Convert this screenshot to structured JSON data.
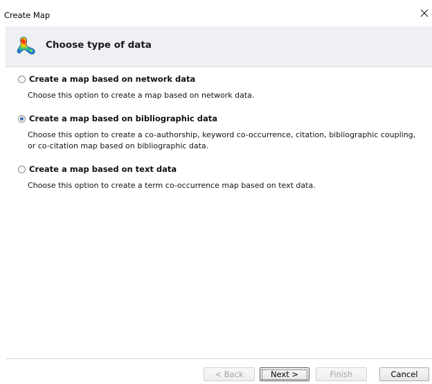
{
  "window": {
    "title": "Create Map"
  },
  "header": {
    "title": "Choose type of data",
    "icon": "vosviewer-map-icon"
  },
  "options": [
    {
      "label": "Create a map based on network data",
      "description": "Choose this option to create a map based on network data.",
      "selected": false
    },
    {
      "label": "Create a map based on bibliographic data",
      "description": "Choose this option to create a co-authorship, keyword co-occurrence, citation, bibliographic coupling, or co-citation map based on bibliographic data.",
      "selected": true
    },
    {
      "label": "Create a map based on text data",
      "description": "Choose this option to create a term co-occurrence map based on text data.",
      "selected": false
    }
  ],
  "buttons": {
    "back": "< Back",
    "next": "Next >",
    "finish": "Finish",
    "cancel": "Cancel"
  },
  "colors": {
    "header_band": "#eef0f4",
    "radio_dot": "#3a6db5"
  }
}
